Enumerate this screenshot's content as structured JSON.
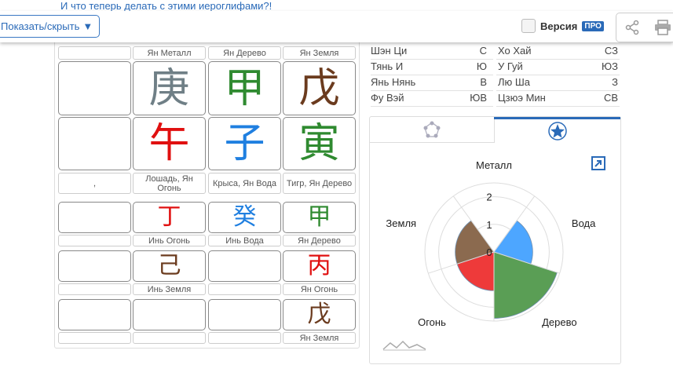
{
  "top_link": "И что теперь делать с этими иероглифами?!",
  "toolbar": {
    "toggle_label": "Показать/скрыть",
    "toggle_arrow": "▼",
    "version_label": "Версия",
    "pro_badge": "ПРО"
  },
  "pillars": {
    "stems": [
      {
        "glyph": "",
        "color": "#000000"
      },
      {
        "glyph": "庚",
        "color": "#6f7f86"
      },
      {
        "glyph": "甲",
        "color": "#2f8a30"
      },
      {
        "glyph": "戊",
        "color": "#6b3b1e"
      }
    ],
    "stem_labels": [
      "",
      "Ян Металл",
      "Ян Дерево",
      "Ян Земля"
    ],
    "branches": [
      {
        "glyph": "",
        "color": "#000000"
      },
      {
        "glyph": "午",
        "color": "#e01010"
      },
      {
        "glyph": "子",
        "color": "#1f7fe0"
      },
      {
        "glyph": "寅",
        "color": "#2f8a30"
      }
    ],
    "branch_labels": [
      ",",
      "Лошадь, Ян Огонь",
      "Крыса, Ян Вода",
      "Тигр, Ян Дерево"
    ],
    "hidden_rows": [
      {
        "glyphs": [
          {
            "glyph": "",
            "color": "#000000"
          },
          {
            "glyph": "丁",
            "color": "#e01010"
          },
          {
            "glyph": "癸",
            "color": "#1f7fe0"
          },
          {
            "glyph": "甲",
            "color": "#2f8a30"
          }
        ],
        "labels": [
          "",
          "Инь Огонь",
          "Инь Вода",
          "Ян Дерево"
        ]
      },
      {
        "glyphs": [
          {
            "glyph": "",
            "color": "#000000"
          },
          {
            "glyph": "己",
            "color": "#6b3b1e"
          },
          {
            "glyph": "",
            "color": "#000000"
          },
          {
            "glyph": "丙",
            "color": "#e01010"
          }
        ],
        "labels": [
          "",
          "Инь Земля",
          "",
          "Ян Огонь"
        ]
      },
      {
        "glyphs": [
          {
            "glyph": "",
            "color": "#000000"
          },
          {
            "glyph": "",
            "color": "#000000"
          },
          {
            "glyph": "",
            "color": "#000000"
          },
          {
            "glyph": "戊",
            "color": "#6b3b1e"
          }
        ],
        "labels": [
          "",
          "",
          "",
          "Ян Земля"
        ]
      }
    ]
  },
  "stars": [
    {
      "left_name": "Шэн Ци",
      "left_dir": "С",
      "right_name": "Хо Хай",
      "right_dir": "СЗ"
    },
    {
      "left_name": "Тянь И",
      "left_dir": "Ю",
      "right_name": "У Гуй",
      "right_dir": "ЮЗ"
    },
    {
      "left_name": "Янь Нянь",
      "left_dir": "В",
      "right_name": "Лю Ша",
      "right_dir": "З"
    },
    {
      "left_name": "Фу Вэй",
      "left_dir": "ЮВ",
      "right_name": "Цзюэ Мин",
      "right_dir": "СВ"
    }
  ],
  "chart_data": {
    "type": "polar-area",
    "categories": [
      "Металл",
      "Вода",
      "Дерево",
      "Огонь",
      "Земля"
    ],
    "values": [
      0,
      1.4,
      2.4,
      1.4,
      1.4
    ],
    "colors": [
      "#888888",
      "#4da6ff",
      "#5a9e55",
      "#ee3a3a",
      "#8b6a4f"
    ],
    "ticks": [
      "0",
      "1",
      "2"
    ],
    "ylim": [
      0,
      2.5
    ]
  }
}
